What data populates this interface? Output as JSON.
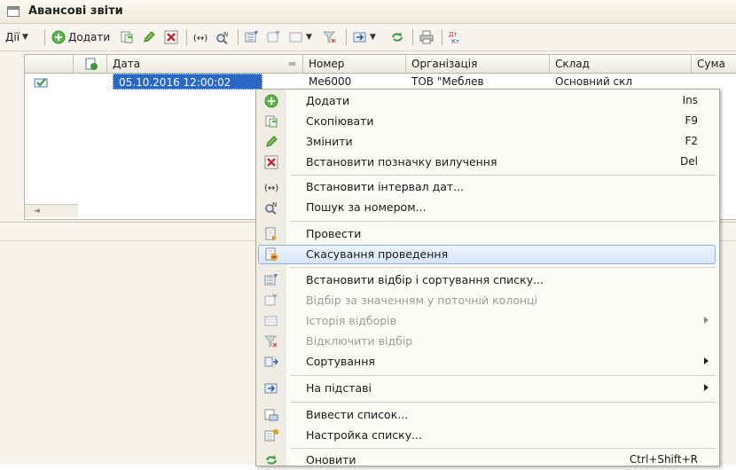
{
  "window": {
    "title": "Авансові звіти"
  },
  "toolbar": {
    "actions_label": "Дії",
    "add_label": "Додати"
  },
  "table": {
    "columns": [
      "Дата",
      "Номер",
      "Організація",
      "Склад",
      "Сума"
    ],
    "row": {
      "date": "05.10.2016 12:00:02",
      "number": "Ме6000",
      "organization": "ТОВ \"Меблев",
      "warehouse": "Основний скл"
    }
  },
  "context_menu": {
    "items": [
      {
        "label": "Додати",
        "shortcut": "Ins",
        "icon": "add-icon"
      },
      {
        "label": "Скопіювати",
        "shortcut": "F9",
        "icon": "copy-icon"
      },
      {
        "label": "Змінити",
        "shortcut": "F2",
        "icon": "edit-icon"
      },
      {
        "label": "Встановити позначку вилучення",
        "shortcut": "Del",
        "icon": "delete-mark-icon"
      },
      {
        "label": "Встановити інтервал дат...",
        "icon": "date-interval-icon"
      },
      {
        "label": "Пошук за номером...",
        "icon": "search-number-icon"
      },
      {
        "label": "Провести",
        "icon": "post-icon"
      },
      {
        "label": "Скасування проведення",
        "icon": "unpost-icon",
        "highlighted": true
      },
      {
        "label": "Встановити відбір і сортування списку...",
        "icon": "filter-sort-icon"
      },
      {
        "label": "Відбір за значенням у поточній колонці",
        "icon": "filter-value-icon",
        "disabled": true
      },
      {
        "label": "Історія відборів",
        "icon": "filter-history-icon",
        "disabled": true,
        "submenu": true
      },
      {
        "label": "Відключити відбір",
        "icon": "filter-off-icon",
        "disabled": true
      },
      {
        "label": "Сортування",
        "icon": "sort-icon",
        "submenu": true
      },
      {
        "label": "На підставі",
        "icon": "based-on-icon",
        "submenu": true
      },
      {
        "label": "Вивести список...",
        "icon": "print-list-icon"
      },
      {
        "label": "Настройка списку...",
        "icon": "list-settings-icon"
      },
      {
        "label": "Оновити",
        "shortcut": "Ctrl+Shift+R",
        "icon": "refresh-icon"
      }
    ]
  },
  "colors": {
    "selection": "#2b67c5",
    "menu_highlight": "#d8e6f8",
    "toolbar_bg": "#f6f4ec"
  }
}
